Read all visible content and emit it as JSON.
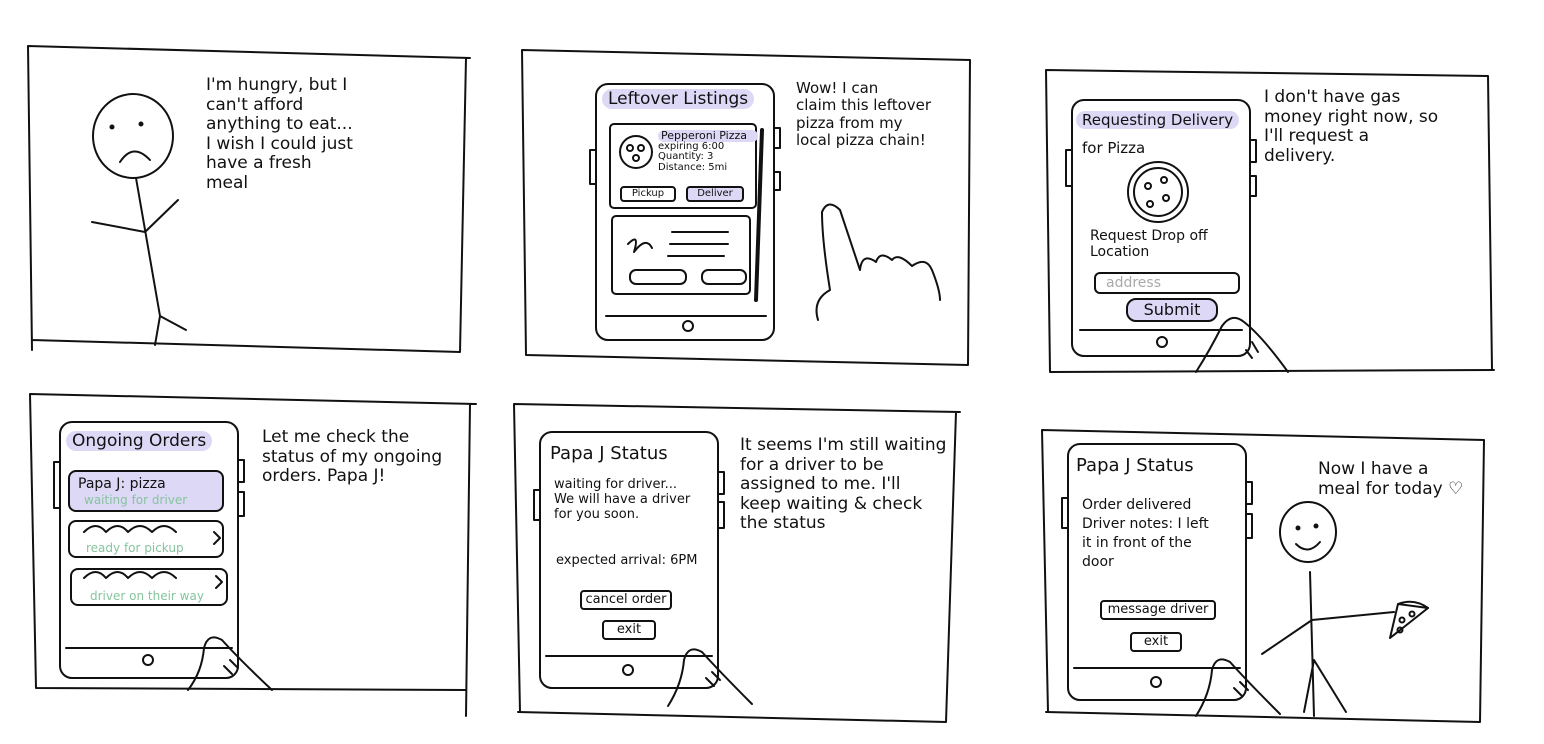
{
  "panels": [
    {
      "caption": "I'm hungry, but I\ncan't afford\nanything to eat...\nI wish I could just\nhave a fresh\nmeal"
    },
    {
      "caption": "Wow! I can\nclaim this leftover\npizza from my\nlocal pizza chain!",
      "screen": {
        "title": "Leftover Listings",
        "listing": {
          "name": "Pepperoni Pizza",
          "expiring": "expiring 6:00",
          "quantity": "Quantity: 3",
          "distance": "Distance: 5mi"
        },
        "pickup_label": "Pickup",
        "deliver_label": "Deliver"
      }
    },
    {
      "caption": "I don't have gas\nmoney right now, so\nI'll request a\ndelivery.",
      "screen": {
        "title": "Requesting Delivery",
        "subtitle": "for Pizza",
        "field_label": "Request Drop off\nLocation",
        "address_placeholder": "address",
        "submit_label": "Submit"
      }
    },
    {
      "caption": "Let me check the\nstatus of my ongoing\norders. Papa J!",
      "screen": {
        "title": "Ongoing Orders",
        "orders": [
          {
            "name": "Papa J: pizza",
            "status": "waiting for driver"
          },
          {
            "name": "",
            "status": "ready for pickup"
          },
          {
            "name": "",
            "status": "driver on their way"
          }
        ]
      }
    },
    {
      "caption": "It seems I'm still waiting\nfor a driver to be\nassigned to me. I'll\nkeep waiting & check\nthe status",
      "screen": {
        "title": "Papa J Status",
        "message": "waiting for driver...\nWe will have a driver\nfor you soon.",
        "arrival": "expected arrival: 6PM",
        "cancel_label": "cancel order",
        "exit_label": "exit"
      }
    },
    {
      "caption": "Now I have a\nmeal for today ♡",
      "screen": {
        "title": "Papa J Status",
        "message": "Order delivered\nDriver notes: I left\nit in front of the\ndoor",
        "message_driver_label": "message driver",
        "exit_label": "exit"
      }
    }
  ],
  "colors": {
    "highlight": "#dcd8f6",
    "status_green": "#86c49d",
    "ink": "#111111"
  }
}
